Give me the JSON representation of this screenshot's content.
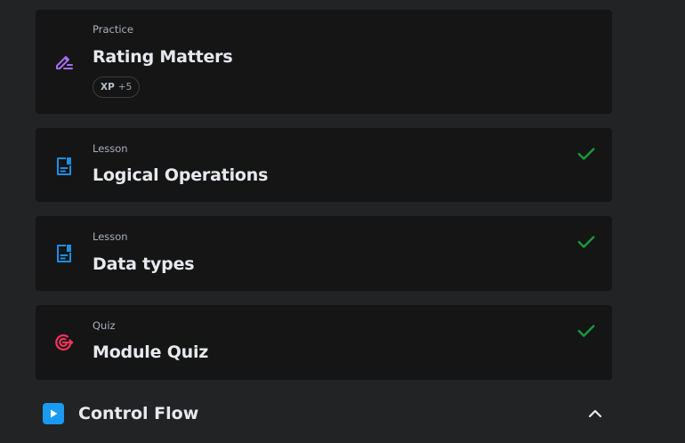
{
  "items": [
    {
      "type": "Practice",
      "title": "Rating Matters",
      "icon": "edit-icon",
      "xp_label": "XP",
      "xp_value": "+5",
      "completed": false
    },
    {
      "type": "Lesson",
      "title": "Logical Operations",
      "icon": "lesson-document-icon",
      "completed": true
    },
    {
      "type": "Lesson",
      "title": "Data types",
      "icon": "lesson-document-icon",
      "completed": true
    },
    {
      "type": "Quiz",
      "title": "Module Quiz",
      "icon": "target-icon",
      "completed": true
    }
  ],
  "next_module": {
    "title": "Control Flow",
    "icon": "play-icon",
    "toggle_icon": "chevron-up-icon"
  },
  "colors": {
    "background": "#222325",
    "card": "#151515",
    "practice_icon": "#a66cf5",
    "lesson_icon": "#1e8ee6",
    "quiz_icon": "#f0345a",
    "check": "#179b3b",
    "module_accent": "#1a9af0"
  }
}
